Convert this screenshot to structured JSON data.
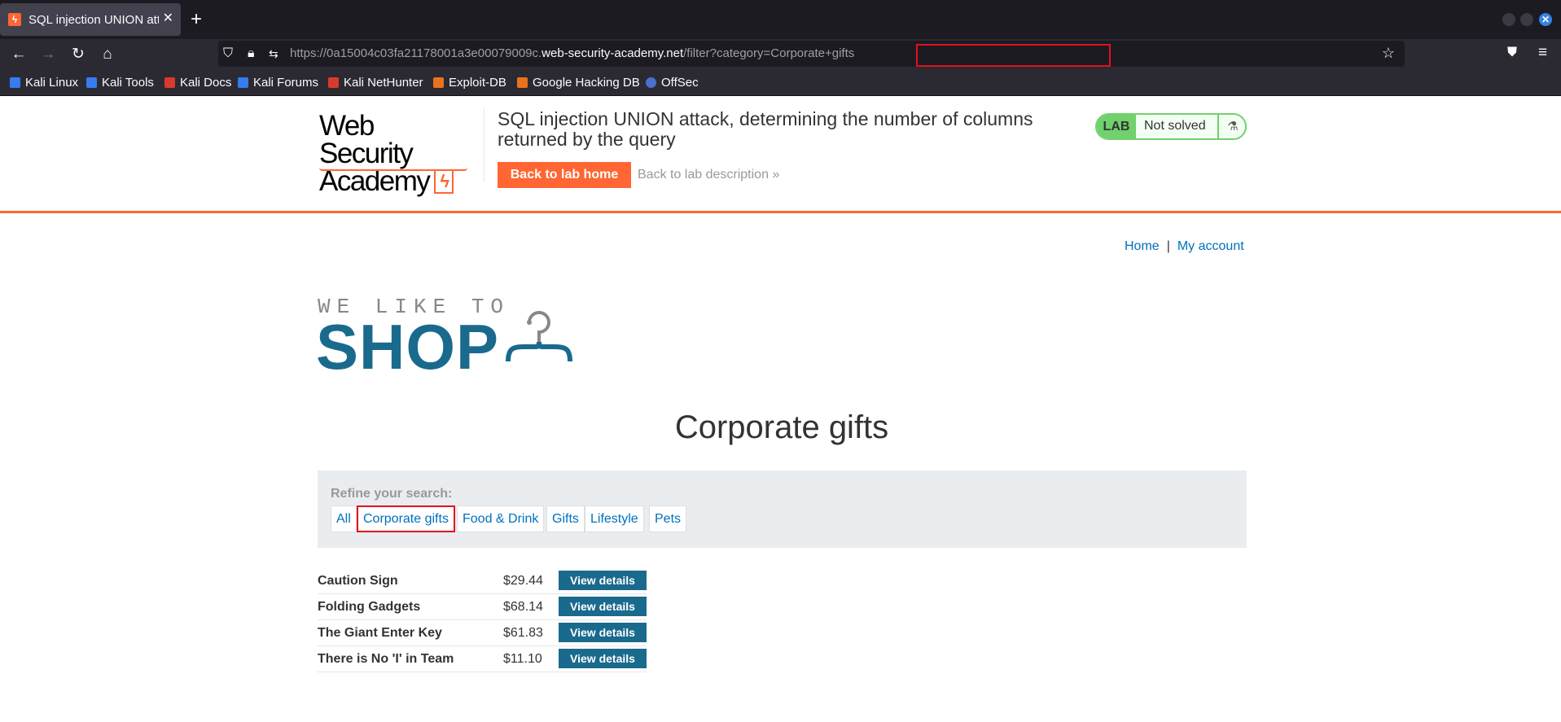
{
  "browser": {
    "tab_title": "SQL injection UNION atta",
    "tab_icon": "burp-bolt-icon",
    "url_prefix": "https://0a15004c03fa21178001a3e00079009c.",
    "url_domain": "web-security-academy.net",
    "url_path": "/filter?category=Corporate+gifts",
    "bookmarks": [
      "Kali Linux",
      "Kali Tools",
      "Kali Docs",
      "Kali Forums",
      "Kali NetHunter",
      "Exploit-DB",
      "Google Hacking DB",
      "OffSec"
    ]
  },
  "lab": {
    "logo_line1": "Web Security",
    "logo_line2": "Academy",
    "title": "SQL injection UNION attack, determining the number of columns returned by the query",
    "back_home": "Back to lab home",
    "back_desc": "Back to lab description",
    "badge_label": "LAB",
    "status": "Not solved",
    "accent_color": "#ff6633"
  },
  "nav": {
    "home": "Home",
    "separator": "|",
    "my_account": "My account"
  },
  "shop": {
    "logo_top": "WE LIKE TO",
    "logo_main": "SHOP",
    "category_title": "Corporate gifts",
    "refine_label": "Refine your search:",
    "filters": [
      "All",
      "Corporate gifts",
      "Food & Drink",
      "Gifts",
      "Lifestyle",
      "Pets"
    ],
    "active_filter": "Corporate gifts"
  },
  "products": [
    {
      "name": "Caution Sign",
      "price": "$29.44",
      "action": "View details"
    },
    {
      "name": "Folding Gadgets",
      "price": "$68.14",
      "action": "View details"
    },
    {
      "name": "The Giant Enter Key",
      "price": "$61.83",
      "action": "View details"
    },
    {
      "name": "There is No 'I' in Team",
      "price": "$11.10",
      "action": "View details"
    }
  ]
}
